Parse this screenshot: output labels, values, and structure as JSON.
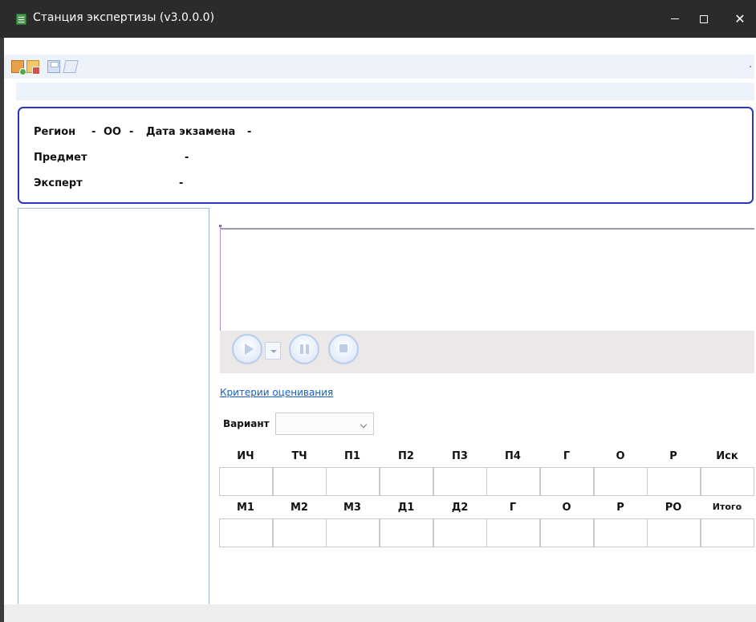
{
  "window": {
    "title": "Станция экспертизы (v3.0.0.0)",
    "minimize_glyph": "",
    "maximize_glyph": "",
    "close_glyph": "✕"
  },
  "toolbar": {
    "icons": [
      "new-document-icon",
      "open-folder-icon",
      "save-icon",
      "print-preview-icon"
    ]
  },
  "info": {
    "region_label": "Регион",
    "region_value": "-",
    "oo_label": "ОО",
    "oo_value": "-",
    "exam_date_label": "Дата экзамена",
    "exam_date_value": "-",
    "subject_label": "Предмет",
    "subject_value": "-",
    "expert_label": "Эксперт",
    "expert_value": "-"
  },
  "media": {
    "controls": [
      "play-icon",
      "dropdown-arrow-icon",
      "pause-icon",
      "stop-icon"
    ]
  },
  "criteria_link": "Критерии оценивания",
  "variant": {
    "label": "Вариант",
    "selected": ""
  },
  "scores_row1": {
    "headers": [
      "ИЧ",
      "ТЧ",
      "П1",
      "П2",
      "П3",
      "П4",
      "Г",
      "О",
      "Р",
      "Иск"
    ],
    "values": [
      "",
      "",
      "",
      "",
      "",
      "",
      "",
      "",
      "",
      ""
    ]
  },
  "scores_row2": {
    "headers": [
      "М1",
      "М2",
      "М3",
      "Д1",
      "Д2",
      "Г",
      "О",
      "Р",
      "РО",
      "Итого"
    ],
    "values": [
      "",
      "",
      "",
      "",
      "",
      "",
      "",
      "",
      "",
      ""
    ]
  },
  "colors": {
    "titlebar": "#2b2b2b",
    "panel_border": "#2a37c8",
    "link": "#1a5fbf"
  }
}
